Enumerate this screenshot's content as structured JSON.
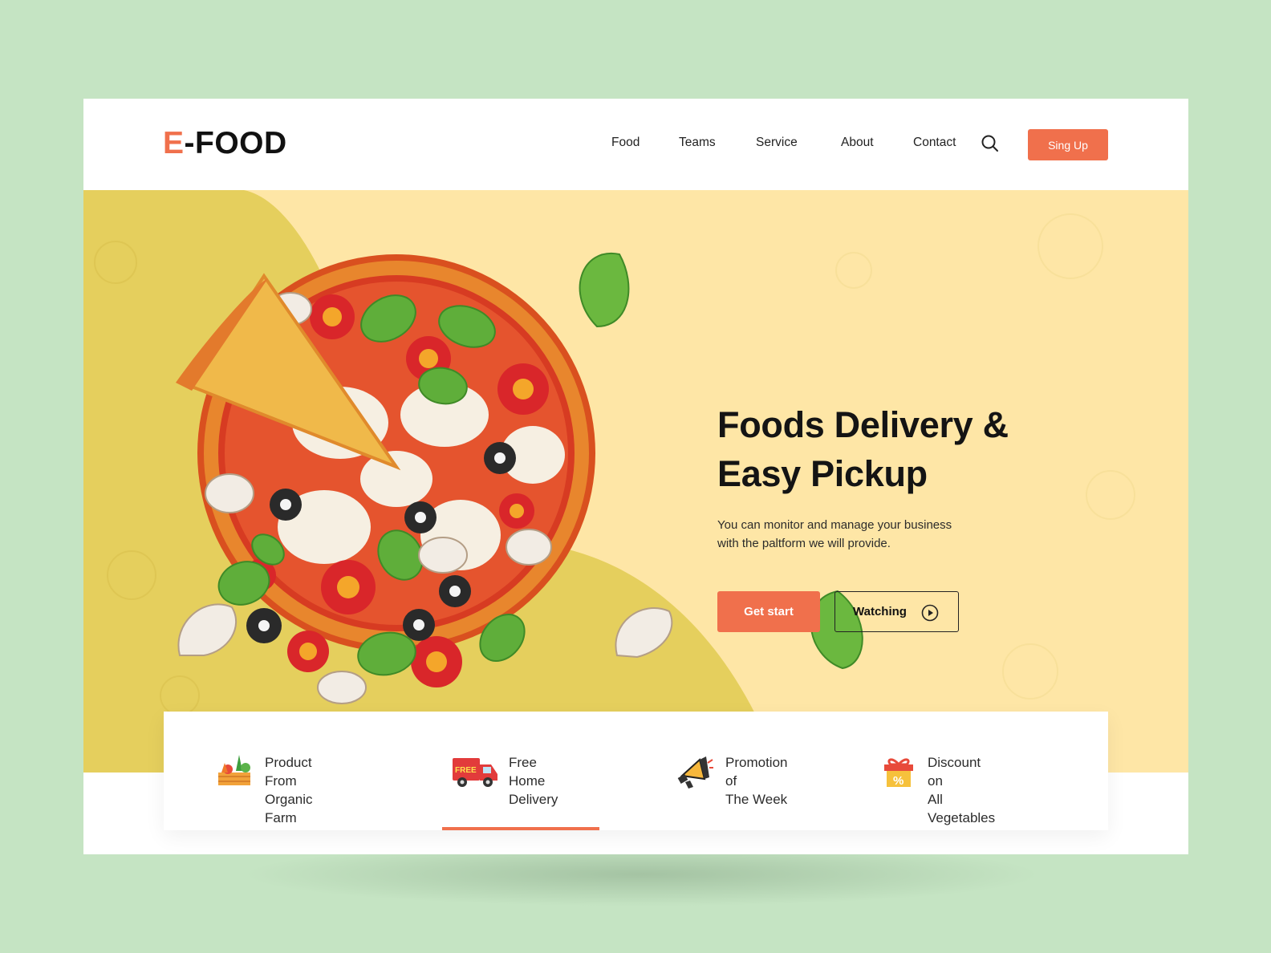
{
  "brand": {
    "logo_prefix": "E",
    "logo_rest": "-FOOD"
  },
  "nav": {
    "links": [
      "Food",
      "Teams",
      "Service",
      "About",
      "Contact"
    ],
    "signup_label": "Sing Up"
  },
  "hero": {
    "headline_line1": "Foods Delivery &",
    "headline_line2": "Easy Pickup",
    "subtext_line1": "You can monitor and manage your business",
    "subtext_line2": "with the paltform we will provide.",
    "primary_button": "Get start",
    "secondary_button": "Watching"
  },
  "features": [
    {
      "line1": "Product From",
      "line2": "Organic Farm",
      "icon": "vegetable-crate-icon"
    },
    {
      "line1": "Free Home",
      "line2": "Delivery",
      "icon": "delivery-truck-icon",
      "badge": "FREE",
      "active": true
    },
    {
      "line1": "Promotion of",
      "line2": "The Week",
      "icon": "megaphone-icon"
    },
    {
      "line1": "Discount on",
      "line2": "All Vegetables",
      "icon": "gift-discount-icon",
      "badge": "%"
    }
  ],
  "colors": {
    "accent": "#f0704c",
    "hero_bg": "#fee6a6",
    "hero_blob": "#e5cf5d",
    "page_bg": "#c5e4c3"
  }
}
